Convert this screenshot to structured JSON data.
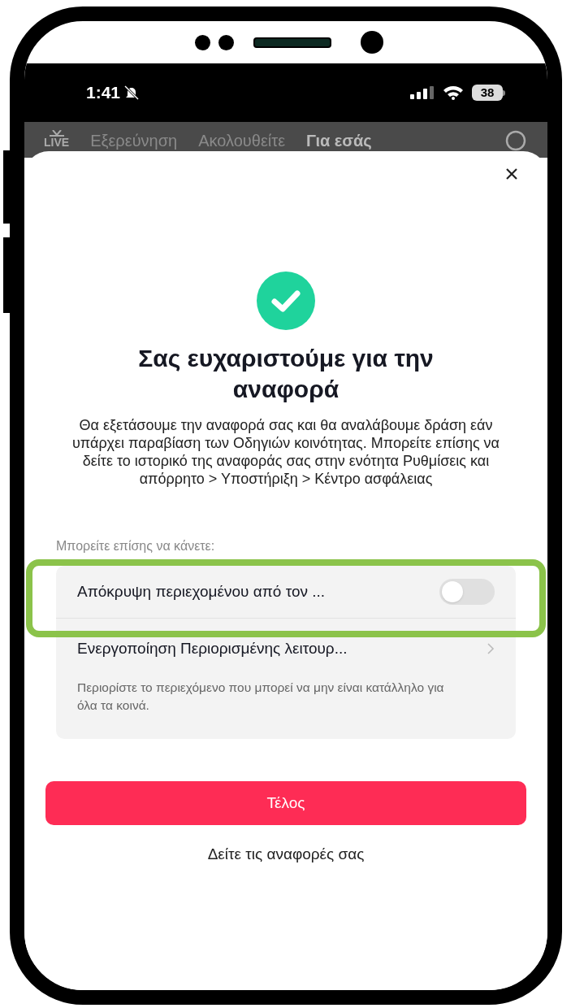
{
  "status_bar": {
    "time": "1:41",
    "silent": true,
    "battery": "38"
  },
  "top_tabs": {
    "live_label": "LIVE",
    "tabs": [
      {
        "label": "Εξερεύνηση",
        "selected": false
      },
      {
        "label": "Ακολουθείτε",
        "selected": false
      },
      {
        "label": "Για εσάς",
        "selected": true
      }
    ]
  },
  "sheet": {
    "title": "Σας ευχαριστούμε για την αναφορά",
    "message": "Θα εξετάσουμε την αναφορά σας και θα αναλάβουμε δράση εάν υπάρχει παραβίαση των Οδηγιών κοινότητας. Μπορείτε επίσης να δείτε το ιστορικό της αναφοράς σας στην ενότητα Ρυθμίσεις και απόρρητο > Υποστήριξη > Κέντρο ασφάλειας",
    "options_label": "Μπορείτε επίσης να κάνετε:",
    "options": [
      {
        "kind": "toggle",
        "label": "Απόκρυψη περιεχομένου από τον ...",
        "on": false,
        "highlighted": true
      },
      {
        "kind": "link",
        "label": "Ενεργοποίηση Περιορισμένης λειτουρ...",
        "description": "Περιορίστε το περιεχόμενο που μπορεί να μην είναι κατάλληλο για όλα τα κοινά."
      }
    ],
    "primary_button": "Τέλος",
    "secondary_link": "Δείτε τις αναφορές σας"
  }
}
